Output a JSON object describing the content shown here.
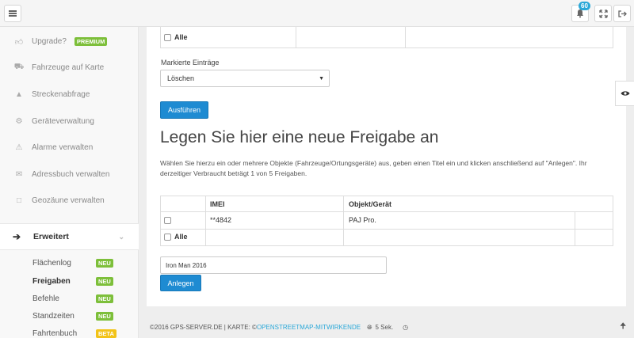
{
  "topbar": {
    "notification_count": "60"
  },
  "sidebar": {
    "items": [
      {
        "label": "Upgrade?",
        "badge": "PREMIUM"
      },
      {
        "label": "Fahrzeuge auf Karte"
      },
      {
        "label": "Streckenabfrage"
      },
      {
        "label": "Geräteverwaltung"
      },
      {
        "label": "Alarme verwalten"
      },
      {
        "label": "Adressbuch verwalten"
      },
      {
        "label": "Geozäune verwalten"
      }
    ],
    "section": {
      "label": "Erweitert"
    },
    "subitems": [
      {
        "label": "Flächenlog",
        "badge": "NEU"
      },
      {
        "label": "Freigaben",
        "badge": "NEU"
      },
      {
        "label": "Befehle",
        "badge": "NEU"
      },
      {
        "label": "Standzeiten",
        "badge": "NEU"
      },
      {
        "label": "Fahrtenbuch",
        "badge": "BETA"
      }
    ]
  },
  "main": {
    "top_table": {
      "all_label": "Alle"
    },
    "bulk": {
      "label": "Markierte Einträge",
      "selected": "Löschen",
      "execute_button": "Ausführen"
    },
    "heading": "Legen Sie hier eine neue Freigabe an",
    "description": "Wählen Sie hierzu ein oder mehrere Objekte (Fahrzeuge/Ortungsgeräte) aus, geben einen Titel ein und klicken anschließend auf \"Anlegen\". Ihr derzeitiger Verbraucht beträgt 1 von 5 Freigaben.",
    "device_table": {
      "headers": [
        "IMEI",
        "Objekt/Gerät"
      ],
      "rows": [
        {
          "imei": "**4842",
          "object": "PAJ Pro."
        }
      ],
      "all_label": "Alle"
    },
    "title_input": {
      "value": "Iron Man 2016"
    },
    "create_button": "Anlegen"
  },
  "footer": {
    "copyright": "©2016 GPS-SERVER.DE | KARTE: © ",
    "map_link": "OPENSTREETMAP-MITWIRKENDE",
    "refresh": "5 Sek."
  }
}
